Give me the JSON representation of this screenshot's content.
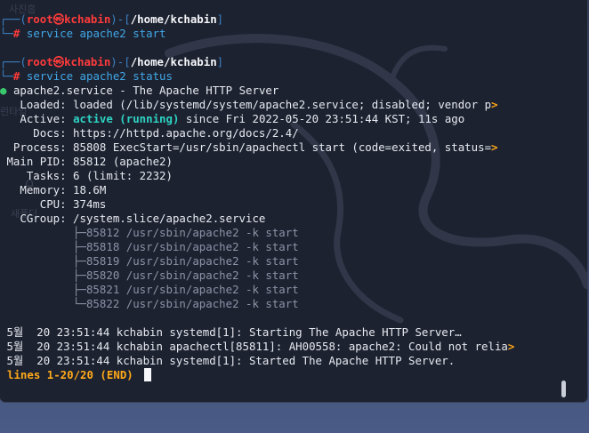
{
  "desktop_ghost": {
    "g1": "사진흡",
    "g2": "런타임",
    "g3": "새폴더"
  },
  "prompt": {
    "box_top_left": "┌──(",
    "user": "root",
    "at": "㉿",
    "host": "kchabin",
    "box_mid": ")-[",
    "path": "/home/kchabin",
    "box_close": "]",
    "box_bottom": "└─",
    "hash": "#"
  },
  "commands": {
    "first": "service apache2 start",
    "second": "service apache2 status"
  },
  "status": {
    "bullet": "●",
    "unit_line": "apache2.service - The Apache HTTP Server",
    "loaded": "   Loaded: loaded (/lib/systemd/system/apache2.service; disabled; vendor p",
    "active_prefix": "   Active: ",
    "active_state": "active (running)",
    "active_suffix": " since Fri 2022-05-20 23:51:44 KST; 11s ago",
    "docs": "     Docs: https://httpd.apache.org/docs/2.4/",
    "process": "  Process: 85808 ExecStart=/usr/sbin/apachectl start (code=exited, status=",
    "main_pid": " Main PID: 85812 (apache2)",
    "tasks": "    Tasks: 6 (limit: 2232)",
    "memory": "   Memory: 18.6M",
    "cpu": "      CPU: 374ms",
    "cgroup": "   CGroup: /system.slice/apache2.service",
    "truncation_marker": ">"
  },
  "cgroup_tree": [
    "           ├─85812 /usr/sbin/apache2 -k start",
    "           ├─85818 /usr/sbin/apache2 -k start",
    "           ├─85819 /usr/sbin/apache2 -k start",
    "           ├─85820 /usr/sbin/apache2 -k start",
    "           ├─85821 /usr/sbin/apache2 -k start",
    "           └─85822 /usr/sbin/apache2 -k start"
  ],
  "journal": [
    " 5월  20 23:51:44 kchabin systemd[1]: Starting The Apache HTTP Server…",
    " 5월  20 23:51:44 kchabin apachectl[85811]: AH00558: apache2: Could not relia",
    " 5월  20 23:51:44 kchabin systemd[1]: Started The Apache HTTP Server."
  ],
  "pager_status": "lines 1-20/20 (END)",
  "colors": {
    "terminal_bg": "#1d2230",
    "prompt_box": "#3b82c4",
    "root_red": "#ff3b3b",
    "command_blue": "#41a7e6",
    "active_cyan": "#2ed3c3",
    "pager_orange": "#ffa91a",
    "bullet_green": "#39c96c"
  }
}
